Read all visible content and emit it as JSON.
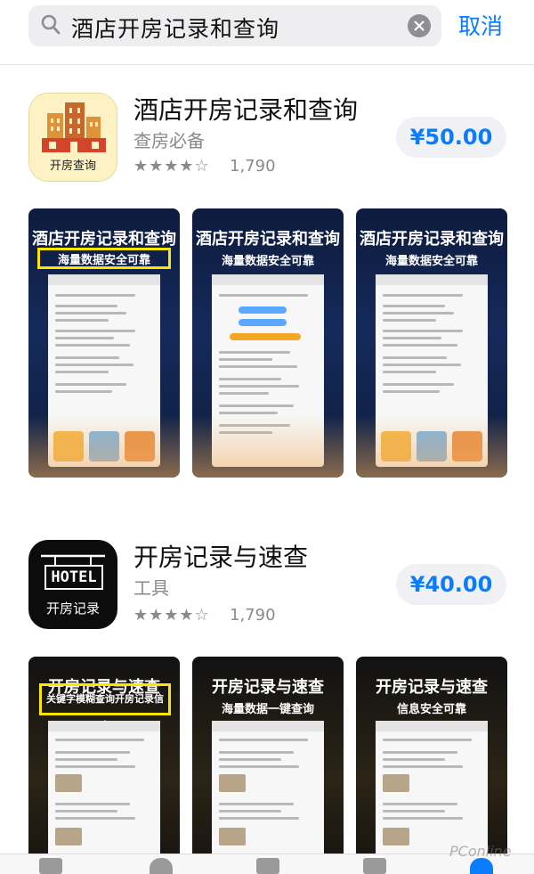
{
  "search": {
    "query": "酒店开房记录和查询",
    "cancel_label": "取消"
  },
  "apps": [
    {
      "name": "酒店开房记录和查询",
      "subtitle": "查房必备",
      "rating_stars": "★★★★☆",
      "rating_count": "1,790",
      "price": "¥50.00",
      "icon_caption": "开房查询",
      "screenshots": [
        {
          "title": "酒店开房记录和查询",
          "subtitle": "海量数据安全可靠"
        },
        {
          "title": "酒店开房记录和查询",
          "subtitle": "海量数据安全可靠"
        },
        {
          "title": "酒店开房记录和查询",
          "subtitle": "海量数据安全可靠"
        }
      ]
    },
    {
      "name": "开房记录与速查",
      "subtitle": "工具",
      "rating_stars": "★★★★☆",
      "rating_count": "1,790",
      "price": "¥40.00",
      "icon_badge": "HOTEL",
      "icon_caption": "开房记录",
      "screenshots": [
        {
          "title": "开房记录与速查",
          "subtitle": "关键字模糊查询开房记录信息"
        },
        {
          "title": "开房记录与速查",
          "subtitle": "海量数据一键查询"
        },
        {
          "title": "开房记录与速查",
          "subtitle": "信息安全可靠"
        }
      ]
    }
  ],
  "watermark": "PConline",
  "colors": {
    "accent": "#0a7cff",
    "highlight_box": "#ffe600"
  },
  "icons": [
    "search-icon",
    "clear-icon",
    "tab-today-icon",
    "tab-games-icon",
    "tab-apps-icon",
    "tab-updates-icon",
    "tab-search-icon"
  ]
}
